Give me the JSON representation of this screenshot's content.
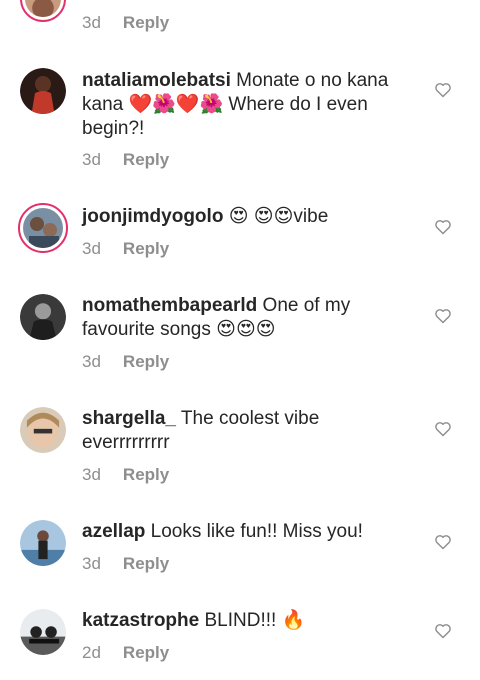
{
  "comments": [
    {
      "user": "",
      "text": "",
      "time": "3d",
      "reply": "Reply"
    },
    {
      "user": "nataliamolebatsi",
      "text": " Monate o no kana kana ❤️🌺❤️🌺 Where do I even begin?!",
      "time": "3d",
      "reply": "Reply"
    },
    {
      "user": "joonjimdyogolo",
      "text": " 😍 😍😍vibe",
      "time": "3d",
      "reply": "Reply"
    },
    {
      "user": "nomathembapearld",
      "text": " One of my favourite songs 😍😍😍",
      "time": "3d",
      "reply": "Reply"
    },
    {
      "user": "shargella_",
      "text": " The coolest vibe everrrrrrrrr",
      "time": "3d",
      "reply": "Reply"
    },
    {
      "user": "azellap",
      "text": " Looks like fun!! Miss you!",
      "time": "3d",
      "reply": "Reply"
    },
    {
      "user": "katzastrophe",
      "text": " BLIND!!! 🔥",
      "time": "2d",
      "reply": "Reply"
    }
  ],
  "colors": {
    "text": "#262626",
    "muted": "#8e8e8e",
    "story_ring": "#e1306c"
  },
  "icons": {
    "like": "heart-outline-icon"
  }
}
